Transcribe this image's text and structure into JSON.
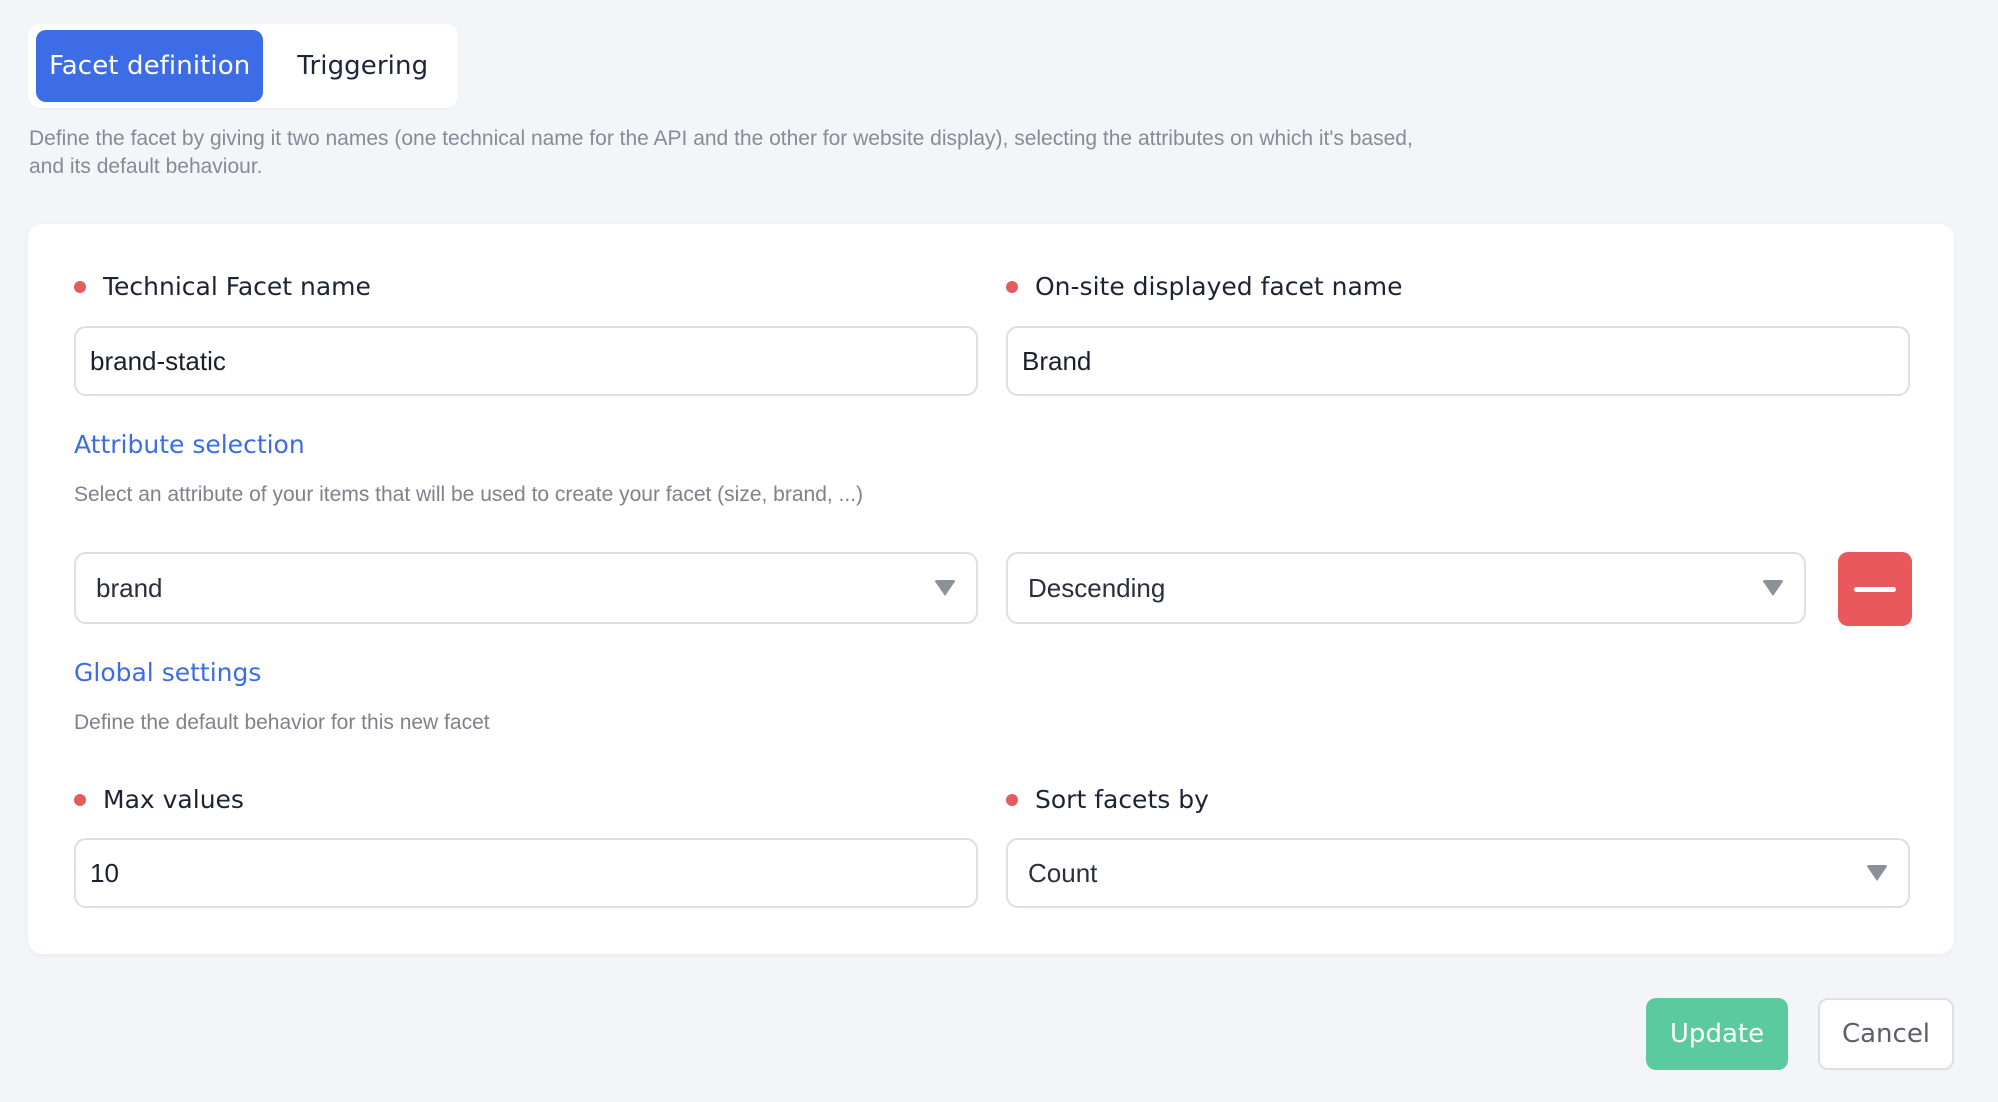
{
  "tabs": [
    {
      "label": "Facet definition",
      "active": true
    },
    {
      "label": "Triggering",
      "active": false
    }
  ],
  "description": "Define the facet by giving it two names (one technical name for the API and the other for website display), selecting the attributes on which it's based, and its default behaviour.",
  "fields": {
    "technical_name": {
      "label": "Technical Facet name",
      "value": "brand-static",
      "required": true
    },
    "display_name": {
      "label": "On-site displayed facet name",
      "value": "Brand",
      "required": true
    }
  },
  "attribute_selection": {
    "title": "Attribute selection",
    "subtitle": "Select an attribute of your items that will be used to create your facet (size, brand, ...)",
    "attribute": "brand",
    "order": "Descending",
    "remove_icon": "minus-icon"
  },
  "global_settings": {
    "title": "Global settings",
    "subtitle": "Define the default behavior for this new facet",
    "max_values": {
      "label": "Max values",
      "value": "10",
      "required": true
    },
    "sort_by": {
      "label": "Sort facets by",
      "value": "Count",
      "required": true
    }
  },
  "actions": {
    "update_label": "Update",
    "cancel_label": "Cancel"
  },
  "colors": {
    "accent": "#3d6ce7",
    "required": "#e35c60",
    "danger": "#e8585c",
    "success": "#5bcb9f"
  }
}
